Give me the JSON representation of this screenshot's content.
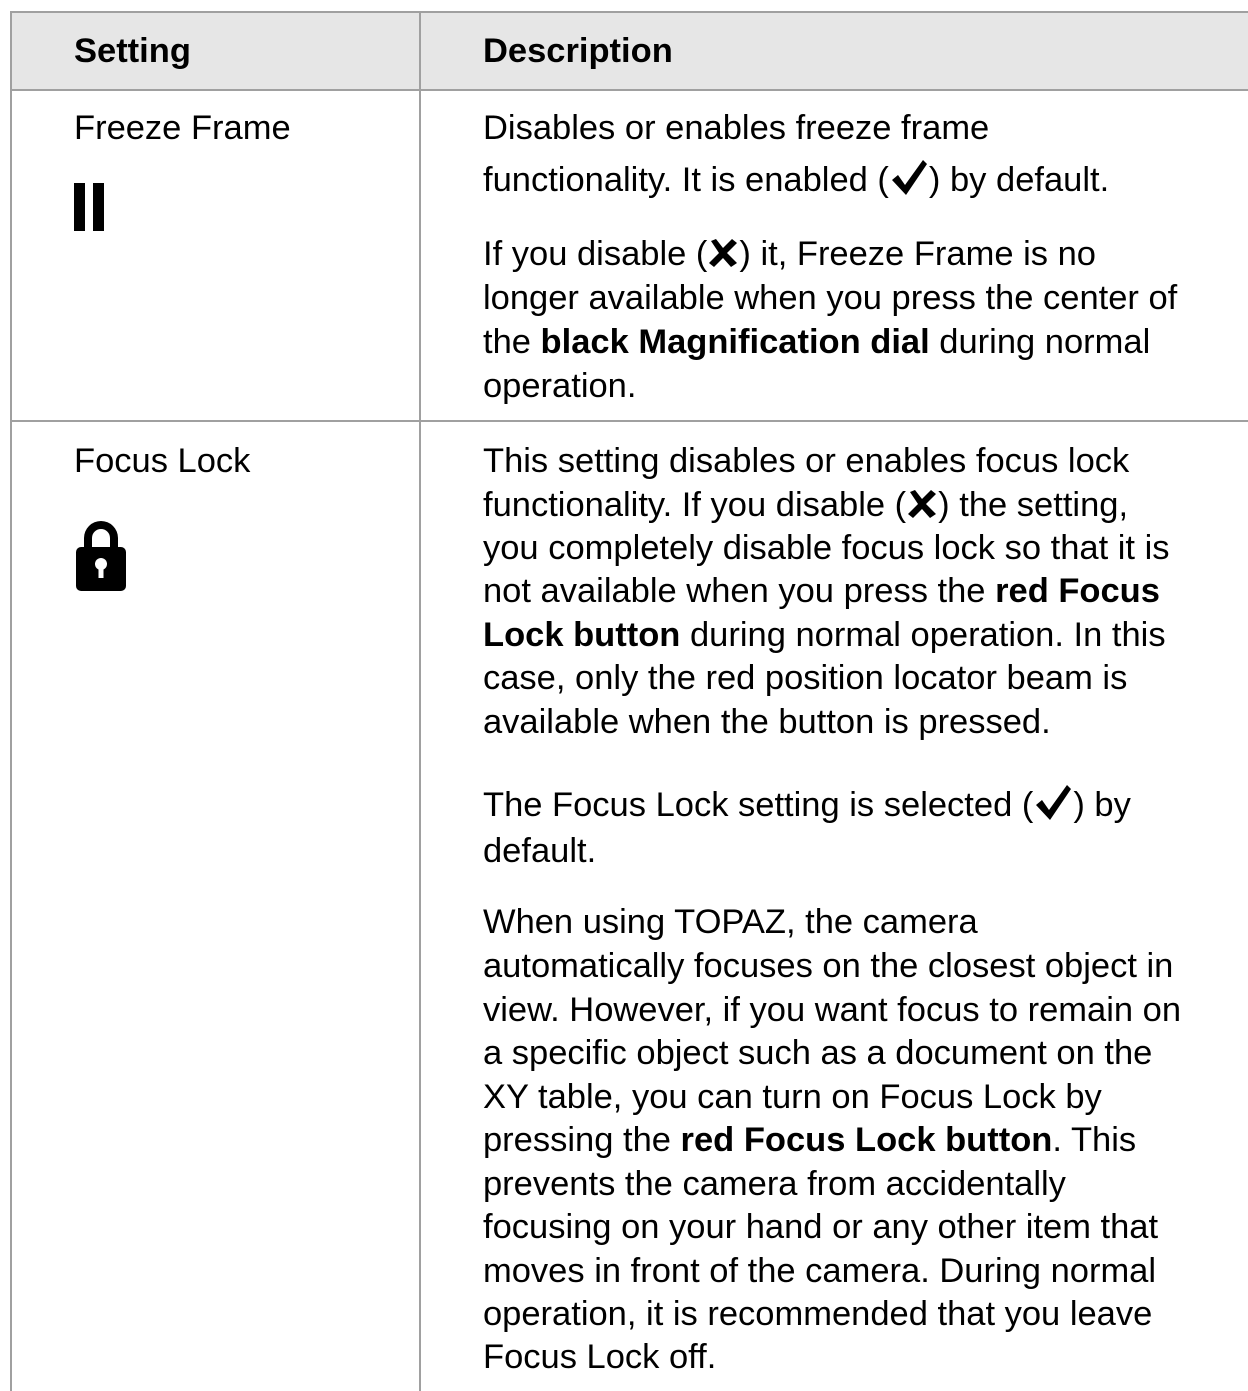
{
  "header": {
    "setting_label": "Setting",
    "description_label": "Description"
  },
  "rows": [
    {
      "setting": "Freeze Frame",
      "icon": "pause-icon",
      "p1": {
        "l1": "Disables or enables freeze frame",
        "l2a": "functionality. It is enabled (",
        "l2b": ") by default."
      },
      "p2": {
        "l1a": "If you disable (",
        "l1b": ") it, Freeze Frame is no",
        "l2": "longer available when you press the center of",
        "l3a": "the ",
        "l3b": "black Magnification dial",
        "l3c": " during normal",
        "l4": "operation."
      }
    },
    {
      "setting": "Focus Lock",
      "icon": "lock-icon",
      "p1": {
        "l1": "This setting disables or enables focus lock",
        "l2a": "functionality. If you disable (",
        "l2b": ") the setting,",
        "l3": "you completely disable focus lock so that it is",
        "l4a": "not available when you press the ",
        "l4b": "red Focus",
        "l5a": "Lock button",
        "l5b": " during normal operation. In this",
        "l6": "case, only the red position locator beam is",
        "l7": "available when the button is pressed."
      },
      "p2": {
        "l1a": "The Focus Lock setting is selected (",
        "l1b": ") by",
        "l2": "default."
      },
      "p3": {
        "l1": "When using TOPAZ, the camera",
        "l2": "automatically focuses on the closest object in",
        "l3": "view. However, if you want focus to remain on",
        "l4": "a specific object such as a document on the",
        "l5": "XY table, you can turn on Focus Lock by",
        "l6a": "pressing the ",
        "l6b": "red Focus Lock button",
        "l6c": ". This",
        "l7": "prevents the camera from accidentally",
        "l8": "focusing on your hand or any other item that",
        "l9": "moves in front of the camera. During normal",
        "l10": "operation, it is recommended that you leave",
        "l11": "Focus Lock off."
      }
    }
  ],
  "symbols": {
    "check": "check-mark-icon",
    "cross": "cross-mark-icon"
  }
}
